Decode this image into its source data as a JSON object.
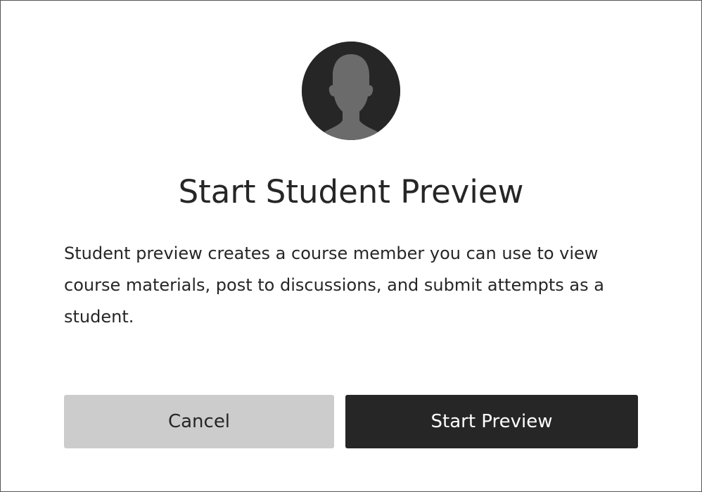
{
  "dialog": {
    "title": "Start Student Preview",
    "description": "Student preview creates a course member you can use to view course materials, post to discussions, and submit attempts as a student.",
    "avatar_icon": "student-avatar-icon",
    "cancel_label": "Cancel",
    "start_label": "Start Preview"
  },
  "colors": {
    "dark": "#262626",
    "avatar_silhouette": "#6b6b6b",
    "cancel_bg": "#cccccc",
    "border": "#555555"
  }
}
